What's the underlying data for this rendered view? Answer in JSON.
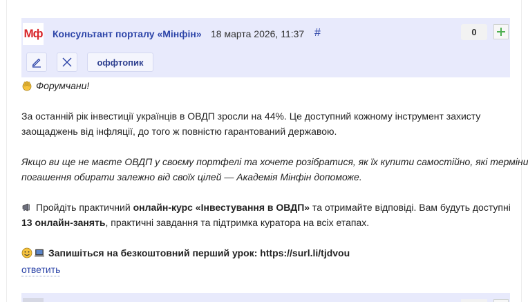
{
  "post": {
    "logo_text": "Мф",
    "author": "Консультант порталу «Мінфін»",
    "date": "18 марта 2026, 11:37",
    "permalink": "#",
    "score": "0",
    "tag": "оффтопик",
    "body": {
      "greeting": "Форумчани!",
      "p1_line1": "За останній рік інвестиції українців в ОВДП зросли на 44%. Це доступний кожному інструмент захисту",
      "p1_line2": "заощаджень від інфляції, до того ж повністю гарантований державою.",
      "p2_line1": "Якщо ви ще не маєте ОВДП у своєму портфелі та хочете розібратися, як їх купити самостійно, які терміни",
      "p2_line2": "погашення обирати залежно від своїх цілей — Академія Мінфін допоможе.",
      "p3_prefix": "Пройдіть практичний ",
      "p3_bold": "онлайн-курс «Інвестування в ОВДП»",
      "p3_suffix": " та отримайте відповіді. Вам будуть доступні",
      "p3_bold2": "13 онлайн-занять",
      "p3_suffix2": ", практичні завдання та підтримка куратора на всіх етапах.",
      "cta": "Запишіться на безкоштовний перший урок: https://surl.li/tjdvou"
    },
    "reply_label": "ответить"
  },
  "icons": {
    "greeting": "waving-hand-icon",
    "announcement": "megaphone-icon",
    "cta_face": "smiling-face-icon",
    "cta_laptop": "laptop-icon"
  },
  "colors": {
    "header_bg": "#e8eafc",
    "link": "#2d45a8",
    "logo_red": "#d8262b",
    "plus_green": "#4caf50"
  }
}
